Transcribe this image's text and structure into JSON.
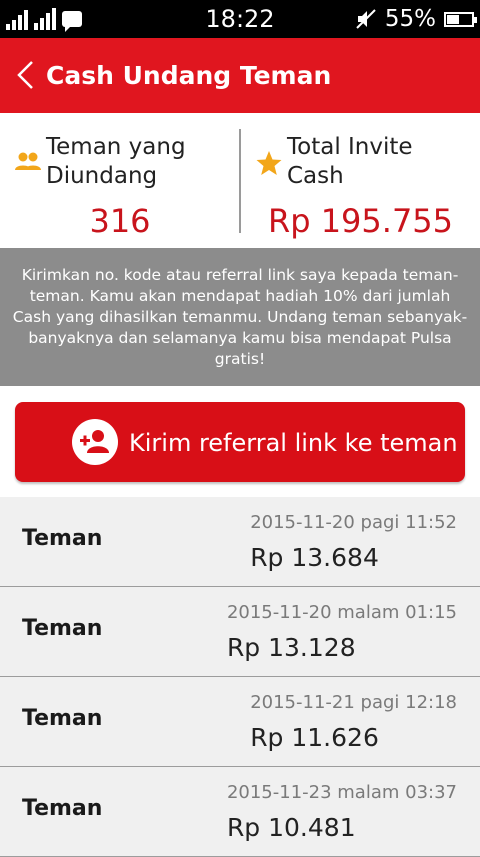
{
  "status_bar": {
    "time": "18:22",
    "battery": "55%",
    "battery_level": 0.55,
    "icons": [
      "signal-icon",
      "data-icon",
      "bbm-icon",
      "mute-icon",
      "battery-icon"
    ]
  },
  "header": {
    "title": "Cash Undang Teman",
    "background": "#e0161f"
  },
  "stats": {
    "invited": {
      "label": "Teman yang Diundang",
      "value": "316",
      "icon": "people-icon"
    },
    "total_cash": {
      "label": "Total Invite Cash",
      "value": "Rp 195.755",
      "icon": "star-icon"
    }
  },
  "info_text": "Kirimkan no. kode atau referral link saya kepada teman-teman. Kamu akan mendapat hadiah 10% dari jumlah Cash yang dihasilkan temanmu. Undang teman sebanyak-banyaknya dan selamanya kamu bisa mendapat Pulsa gratis!",
  "cta": {
    "label": "Kirim referral link ke teman",
    "icon": "add-person-icon"
  },
  "rows": [
    {
      "name": "Teman",
      "date": "2015-11-20 pagi 11:52",
      "amount": "Rp 13.684"
    },
    {
      "name": "Teman",
      "date": "2015-11-20 malam 01:15",
      "amount": "Rp 13.128"
    },
    {
      "name": "Teman",
      "date": "2015-11-21 pagi 12:18",
      "amount": "Rp 11.626"
    },
    {
      "name": "Teman",
      "date": "2015-11-23 malam 03:37",
      "amount": "Rp 10.481"
    }
  ],
  "colors": {
    "accent": "#e0161f",
    "value_red": "#c8141c",
    "info_bg": "#8c8c8c",
    "row_bg": "#f0f0f0"
  }
}
